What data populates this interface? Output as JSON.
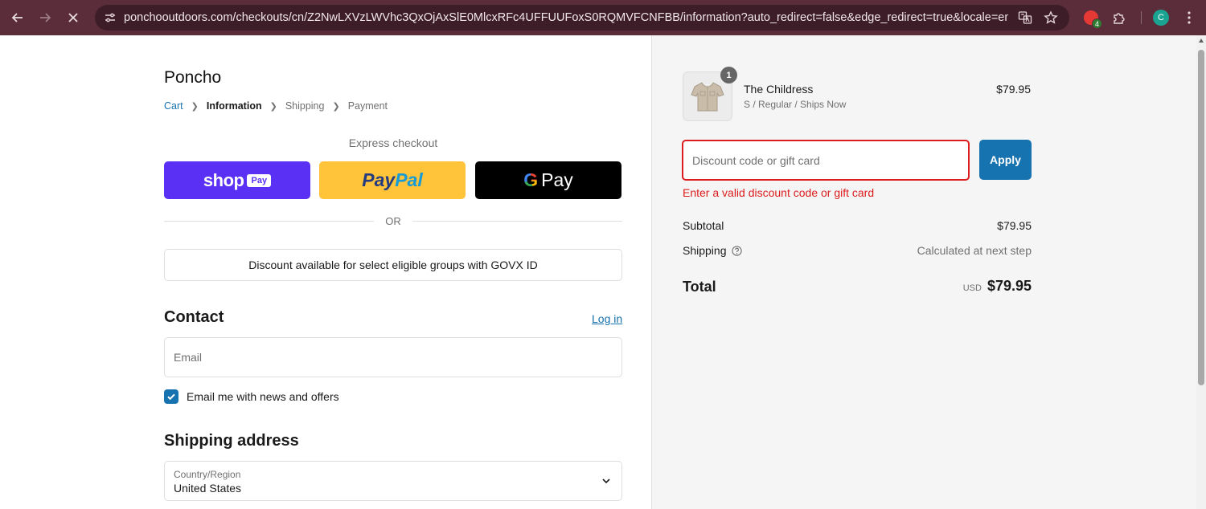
{
  "browser": {
    "url": "ponchooutdoors.com/checkouts/cn/Z2NwLXVzLWVhc3QxOjAxSlE0MlcxRFc4UFFUUFoxS0RQMVFCNFBB/information?auto_redirect=false&edge_redirect=true&locale=en-US&skip_s...",
    "profile_initial": "C",
    "extension_badge": "4",
    "icons": {
      "back": "arrow-left-icon",
      "forward": "arrow-right-icon",
      "stop": "close-icon",
      "site_info": "tune-icon",
      "translate": "translate-icon",
      "bookmark": "star-icon",
      "extensions": "puzzle-icon",
      "menu": "kebab-menu-icon"
    }
  },
  "checkout": {
    "brand": "Poncho",
    "breadcrumbs": [
      {
        "label": "Cart",
        "state": "link"
      },
      {
        "label": "Information",
        "state": "current"
      },
      {
        "label": "Shipping",
        "state": "upcoming"
      },
      {
        "label": "Payment",
        "state": "upcoming"
      }
    ],
    "express_label": "Express checkout",
    "express_buttons": {
      "shop_word": "shop",
      "shop_pay_tag": "Pay",
      "paypal_part1": "Pay",
      "paypal_part2": "Pal",
      "gpay_g": "G",
      "gpay_word": "Pay"
    },
    "or_label": "OR",
    "govx_label": "Discount available for select eligible groups with GOVX ID",
    "contact": {
      "heading": "Contact",
      "login_label": "Log in",
      "email_placeholder": "Email",
      "email_value": "",
      "newsletter_label": "Email me with news and offers",
      "newsletter_checked": true
    },
    "shipping": {
      "heading": "Shipping address",
      "country_label": "Country/Region",
      "country_value": "United States"
    }
  },
  "summary": {
    "product": {
      "quantity": "1",
      "name": "The Childress",
      "variant": "S / Regular / Ships Now",
      "price": "$79.95",
      "image_icon": "shirt-icon"
    },
    "discount": {
      "placeholder": "Discount code or gift card",
      "value": "",
      "apply_label": "Apply",
      "error": "Enter a valid discount code or gift card"
    },
    "subtotal_label": "Subtotal",
    "subtotal_value": "$79.95",
    "shipping_label": "Shipping",
    "shipping_value": "Calculated at next step",
    "total_label": "Total",
    "total_currency": "USD",
    "total_value": "$79.95"
  },
  "colors": {
    "accent": "#1773b0",
    "error": "#dd1d1d",
    "shop_pay": "#5a31f4",
    "paypal": "#ffc439",
    "chrome": "#5b2c3a"
  }
}
